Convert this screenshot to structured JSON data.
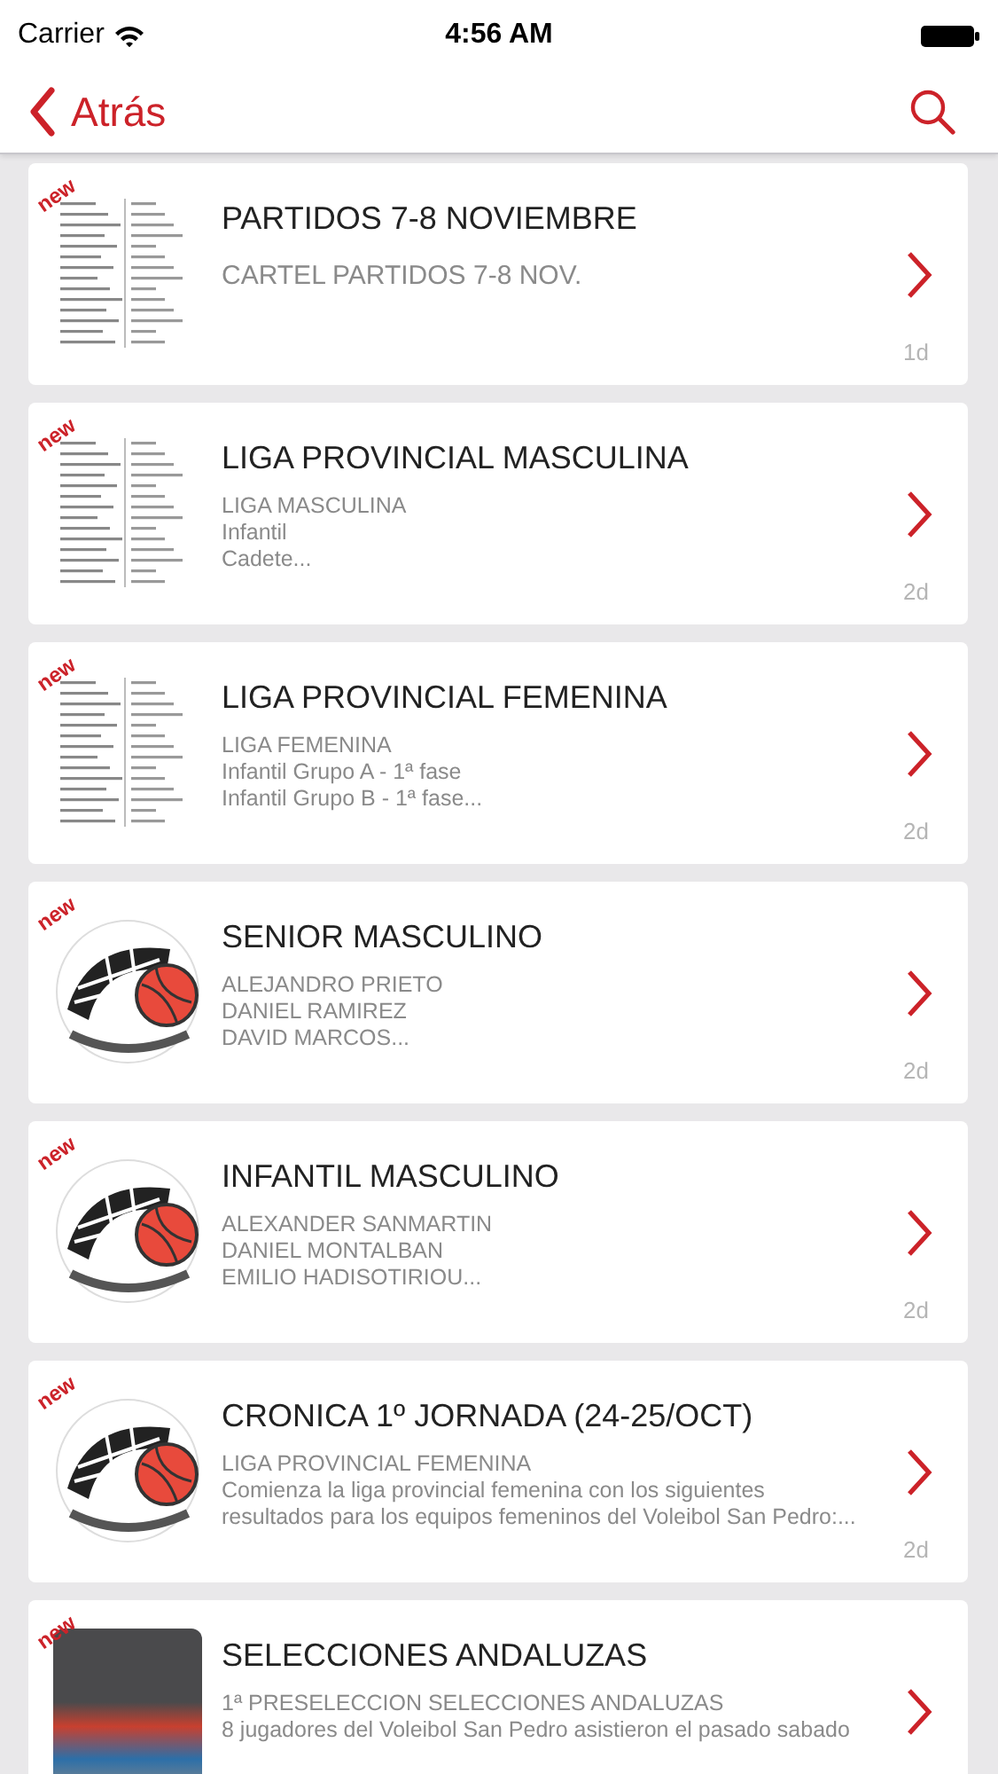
{
  "status_bar": {
    "carrier": "Carrier",
    "time": "4:56 AM"
  },
  "nav_bar": {
    "back_label": "Atrás"
  },
  "items": [
    {
      "title": "PARTIDOS 7-8 NOVIEMBRE",
      "lines": [
        "CARTEL PARTIDOS 7-8 NOV."
      ],
      "age": "1d",
      "badge": "new",
      "kind": "document"
    },
    {
      "title": "LIGA PROVINCIAL MASCULINA",
      "lines": [
        "LIGA MASCULINA",
        "Infantil",
        "Cadete..."
      ],
      "age": "2d",
      "badge": "new",
      "kind": "document"
    },
    {
      "title": "LIGA PROVINCIAL FEMENINA",
      "lines": [
        "LIGA FEMENINA",
        "Infantil Grupo A - 1ª fase",
        "Infantil Grupo B - 1ª fase..."
      ],
      "age": "2d",
      "badge": "new",
      "kind": "document"
    },
    {
      "title": "SENIOR MASCULINO",
      "lines": [
        "ALEJANDRO PRIETO",
        "DANIEL RAMIREZ",
        "DAVID MARCOS..."
      ],
      "age": "2d",
      "badge": "new",
      "kind": "logo"
    },
    {
      "title": "INFANTIL MASCULINO",
      "lines": [
        "ALEXANDER SANMARTIN",
        "DANIEL MONTALBAN",
        "EMILIO HADISOTIRIOU..."
      ],
      "age": "2d",
      "badge": "new",
      "kind": "logo"
    },
    {
      "title": "CRONICA 1º JORNADA (24-25/OCT)",
      "lines": [
        "LIGA PROVINCIAL FEMENINA",
        "Comienza la liga provincial femenina con los siguientes",
        "resultados para los equipos femeninos del Voleibol San Pedro:..."
      ],
      "age": "2d",
      "badge": "new",
      "kind": "logo"
    },
    {
      "title": "SELECCIONES ANDALUZAS",
      "lines": [
        "1ª PRESELECCION SELECCIONES ANDALUZAS",
        "8 jugadores del Voleibol San Pedro asistieron el pasado sabado"
      ],
      "badge": "new",
      "kind": "photo"
    }
  ]
}
